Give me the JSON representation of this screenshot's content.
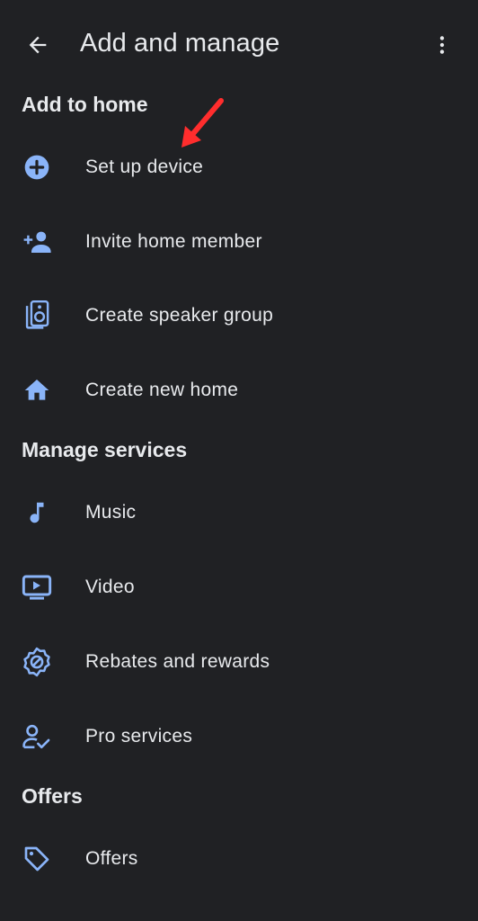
{
  "header": {
    "title": "Add and manage",
    "back_icon": "arrow-back-icon",
    "more_icon": "more-vert-icon"
  },
  "sections": {
    "add_to_home": {
      "title": "Add to home",
      "items": [
        {
          "label": "Set up device",
          "icon": "add-circle-icon"
        },
        {
          "label": "Invite home member",
          "icon": "person-add-icon"
        },
        {
          "label": "Create speaker group",
          "icon": "speaker-icon"
        },
        {
          "label": "Create new home",
          "icon": "home-icon"
        }
      ]
    },
    "manage_services": {
      "title": "Manage services",
      "items": [
        {
          "label": "Music",
          "icon": "music-note-icon"
        },
        {
          "label": "Video",
          "icon": "video-icon"
        },
        {
          "label": "Rebates and rewards",
          "icon": "rewards-badge-icon"
        },
        {
          "label": "Pro services",
          "icon": "pro-services-icon"
        }
      ]
    },
    "offers": {
      "title": "Offers",
      "items": [
        {
          "label": "Offers",
          "icon": "tag-icon"
        }
      ]
    }
  },
  "colors": {
    "background": "#202124",
    "text": "#e8eaed",
    "icon_accent": "#8ab4f8",
    "annotation_arrow": "#ff2d2d"
  }
}
